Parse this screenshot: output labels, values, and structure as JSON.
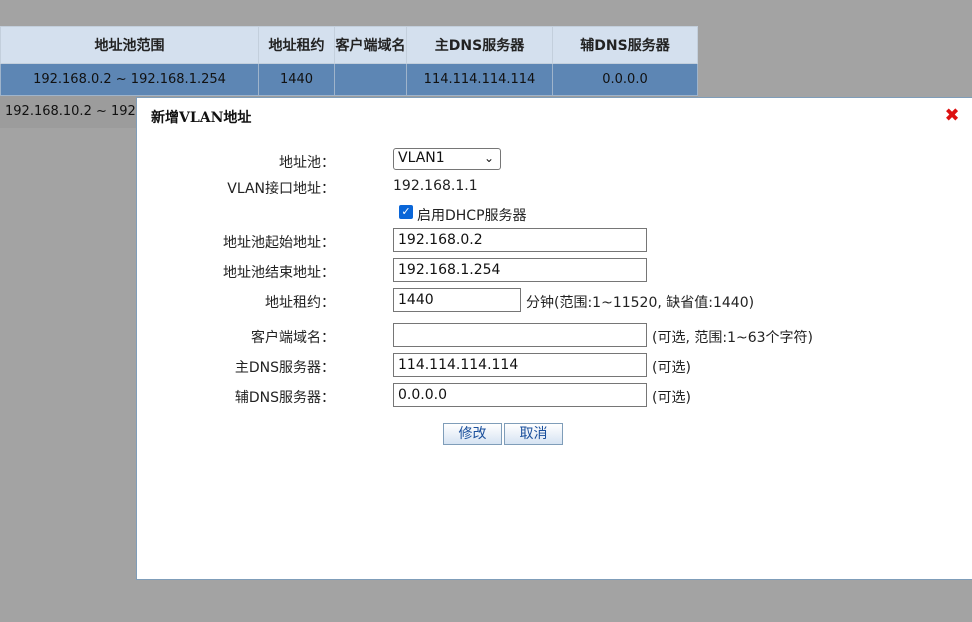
{
  "pool_table": {
    "headers": [
      "地址池范围",
      "地址租约",
      "客户端域名",
      "主DNS服务器",
      "辅DNS服务器"
    ],
    "rows": [
      [
        "192.168.0.2 ~ 192.168.1.254",
        "1440",
        "",
        "114.114.114.114",
        "0.0.0.0"
      ],
      [
        "192.168.10.2 ~ 192",
        "",
        "",
        "",
        ""
      ]
    ]
  },
  "dialog": {
    "title": "新增VLAN地址",
    "close_icon": "close-x-icon",
    "fields": {
      "pool": {
        "label": "地址池：",
        "selected": "VLAN1"
      },
      "vlan_ip": {
        "label": "VLAN接口地址：",
        "value": "192.168.1.1"
      },
      "dhcp": {
        "label": "启用DHCP服务器",
        "checked": true
      },
      "start": {
        "label": "地址池起始地址：",
        "value": "192.168.0.2"
      },
      "end": {
        "label": "地址池结束地址：",
        "value": "192.168.1.254"
      },
      "lease": {
        "label": "地址租约：",
        "value": "1440",
        "hint": "分钟(范围:1~11520, 缺省值:1440)"
      },
      "domain": {
        "label": "客户端域名：",
        "value": "",
        "hint": "(可选, 范围:1~63个字符)"
      },
      "dns1": {
        "label": "主DNS服务器：",
        "value": "114.114.114.114",
        "hint": "(可选)"
      },
      "dns2": {
        "label": "辅DNS服务器：",
        "value": "0.0.0.0",
        "hint": "(可选)"
      }
    },
    "buttons": {
      "modify": "修改",
      "cancel": "取消"
    }
  },
  "colors": {
    "selected_row": "#5d86b4",
    "header_bg": "#d4e0ee",
    "overlay": "#a3a3a3",
    "close_red": "#dd1111",
    "checkbox": "#0a66d8"
  }
}
